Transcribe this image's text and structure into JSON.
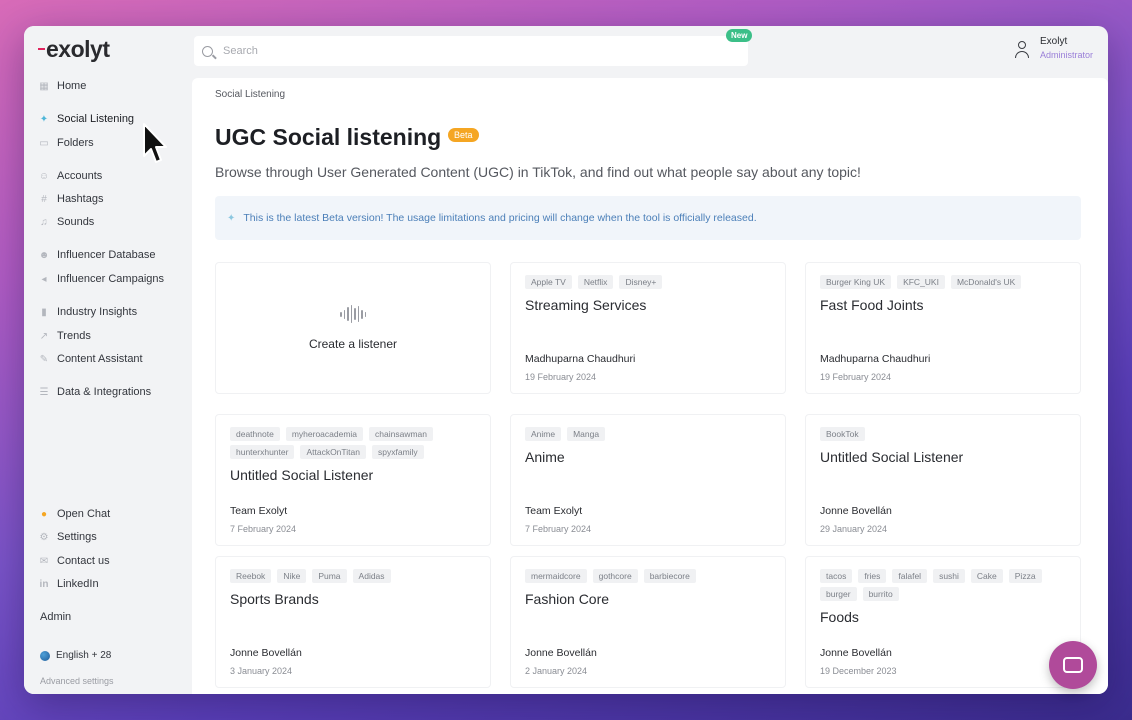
{
  "app": {
    "logo_text": "exolyt"
  },
  "search": {
    "placeholder": "Search",
    "badge": "New"
  },
  "user": {
    "name": "Exolyt",
    "role": "Administrator"
  },
  "sidebar": {
    "items": [
      {
        "label": "Home",
        "icon": "grid-icon"
      },
      {
        "label": "Social Listening",
        "icon": "sparkle-icon"
      },
      {
        "label": "Folders",
        "icon": "folder-icon"
      },
      {
        "label": "Accounts",
        "icon": "users-icon"
      },
      {
        "label": "Hashtags",
        "icon": "hashtag-icon"
      },
      {
        "label": "Sounds",
        "icon": "music-icon"
      },
      {
        "label": "Influencer Database",
        "icon": "person-icon"
      },
      {
        "label": "Influencer Campaigns",
        "icon": "megaphone-icon"
      },
      {
        "label": "Industry Insights",
        "icon": "bar-chart-icon"
      },
      {
        "label": "Trends",
        "icon": "trend-icon"
      },
      {
        "label": "Content Assistant",
        "icon": "wand-icon"
      },
      {
        "label": "Data & Integrations",
        "icon": "database-icon"
      }
    ],
    "bottom_items": [
      {
        "label": "Open Chat",
        "icon": "dot-icon"
      },
      {
        "label": "Settings",
        "icon": "gear-icon"
      },
      {
        "label": "Contact us",
        "icon": "chat-icon"
      },
      {
        "label": "LinkedIn",
        "icon": "linkedin-icon"
      }
    ],
    "admin_label": "Admin",
    "language": "English + 28",
    "advanced_settings": "Advanced settings"
  },
  "main": {
    "breadcrumb": "Social Listening",
    "title": "UGC Social listening",
    "beta_badge": "Beta",
    "subtitle": "Browse through User Generated Content (UGC) in TikTok, and find out what people say about any topic!",
    "notice": "This is the latest Beta version! The usage limitations and pricing will change when the tool is officially released.",
    "create_label": "Create a listener",
    "cards": [
      {
        "tags": [
          "Apple TV",
          "Netflix",
          "Disney+"
        ],
        "title": "Streaming Services",
        "author": "Madhuparna Chaudhuri",
        "date": "19 February 2024"
      },
      {
        "tags": [
          "Burger King UK",
          "KFC_UKI",
          "McDonald's UK"
        ],
        "title": "Fast Food Joints",
        "author": "Madhuparna Chaudhuri",
        "date": "19 February 2024"
      },
      {
        "tags": [
          "deathnote",
          "myheroacademia",
          "chainsawman",
          "hunterxhunter",
          "AttackOnTitan",
          "spyxfamily"
        ],
        "title": "Untitled Social Listener",
        "author": "Team Exolyt",
        "date": "7 February 2024"
      },
      {
        "tags": [
          "Anime",
          "Manga"
        ],
        "title": "Anime",
        "author": "Team Exolyt",
        "date": "7 February 2024"
      },
      {
        "tags": [
          "BookTok"
        ],
        "title": "Untitled Social Listener",
        "author": "Jonne Bovellán",
        "date": "29 January 2024"
      },
      {
        "tags": [
          "Reebok",
          "Nike",
          "Puma",
          "Adidas"
        ],
        "title": "Sports Brands",
        "author": "Jonne Bovellán",
        "date": "3 January 2024"
      },
      {
        "tags": [
          "mermaidcore",
          "gothcore",
          "barbiecore"
        ],
        "title": "Fashion Core",
        "author": "Jonne Bovellán",
        "date": "2 January 2024"
      },
      {
        "tags": [
          "tacos",
          "fries",
          "falafel",
          "sushi",
          "Cake",
          "Pizza",
          "burger",
          "burrito"
        ],
        "title": "Foods",
        "author": "Jonne Bovellán",
        "date": "19 December 2023"
      }
    ]
  },
  "colors": {
    "accent": "#4fb6d8",
    "beta": "#f5a623",
    "new_badge": "#3cbf88",
    "chat": "#b04a9a",
    "logo_dash": "#e0245e"
  }
}
